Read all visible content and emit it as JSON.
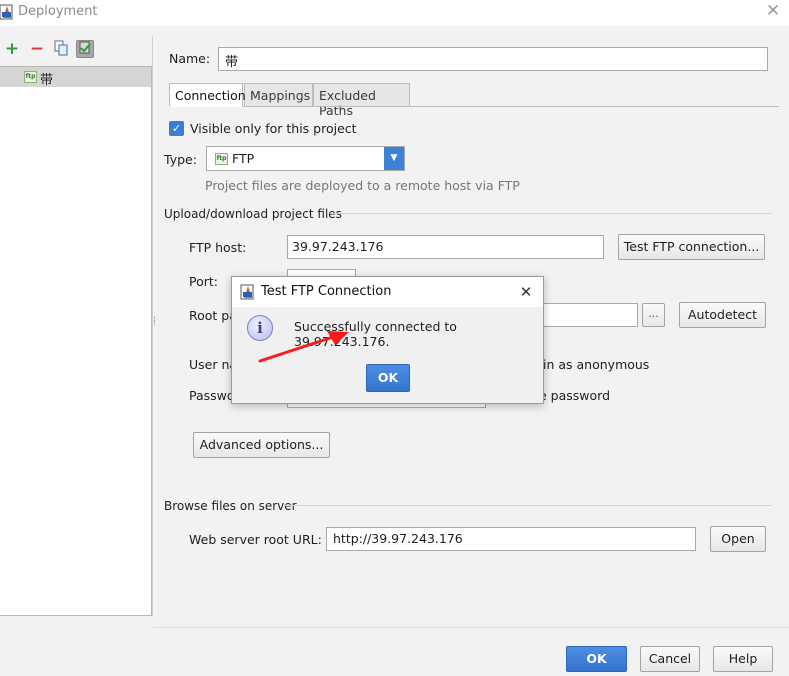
{
  "window": {
    "title": "Deployment",
    "close_glyph": "✕",
    "icon": "ftp-app-icon"
  },
  "left_panel": {
    "toolbar": {
      "add_glyph": "+",
      "remove_glyph": "−"
    },
    "servers": [
      {
        "name": "带",
        "type_badge": "ftp"
      }
    ]
  },
  "form": {
    "name_label": "Name:",
    "name_value": "带",
    "tabs": [
      "Connection",
      "Mappings",
      "Excluded Paths"
    ],
    "visible_only_label": "Visible only for this project",
    "visible_only_checked": true,
    "type_label": "Type:",
    "type_value": "FTP",
    "type_description": "Project files are deployed to a remote host via FTP",
    "upload_section": "Upload/download project files",
    "ftp_host_label": "FTP host:",
    "ftp_host_value": "39.97.243.176",
    "test_button": "Test FTP connection...",
    "port_label": "Port:",
    "root_path_label": "Root pa",
    "browse_button": "...",
    "autodetect_button": "Autodetect",
    "username_label": "User na",
    "anonymous_label": "in as anonymous",
    "password_label": "Passwo",
    "save_password_label": "e password",
    "advanced_button": "Advanced options...",
    "browse_section": "Browse files on server",
    "web_url_label": "Web server root URL:",
    "web_url_value": "http://39.97.243.176",
    "open_button": "Open"
  },
  "footer": {
    "ok": "OK",
    "cancel": "Cancel",
    "help": "Help"
  },
  "dialog": {
    "title": "Test FTP Connection",
    "close_glyph": "✕",
    "message": "Successfully connected to 39.97.243.176.",
    "ok": "OK",
    "icon": "info-icon"
  },
  "annotation": {
    "color": "#ff1a1a"
  },
  "colors": {
    "accent": "#3e82d6",
    "check": "#3d7ed2"
  }
}
